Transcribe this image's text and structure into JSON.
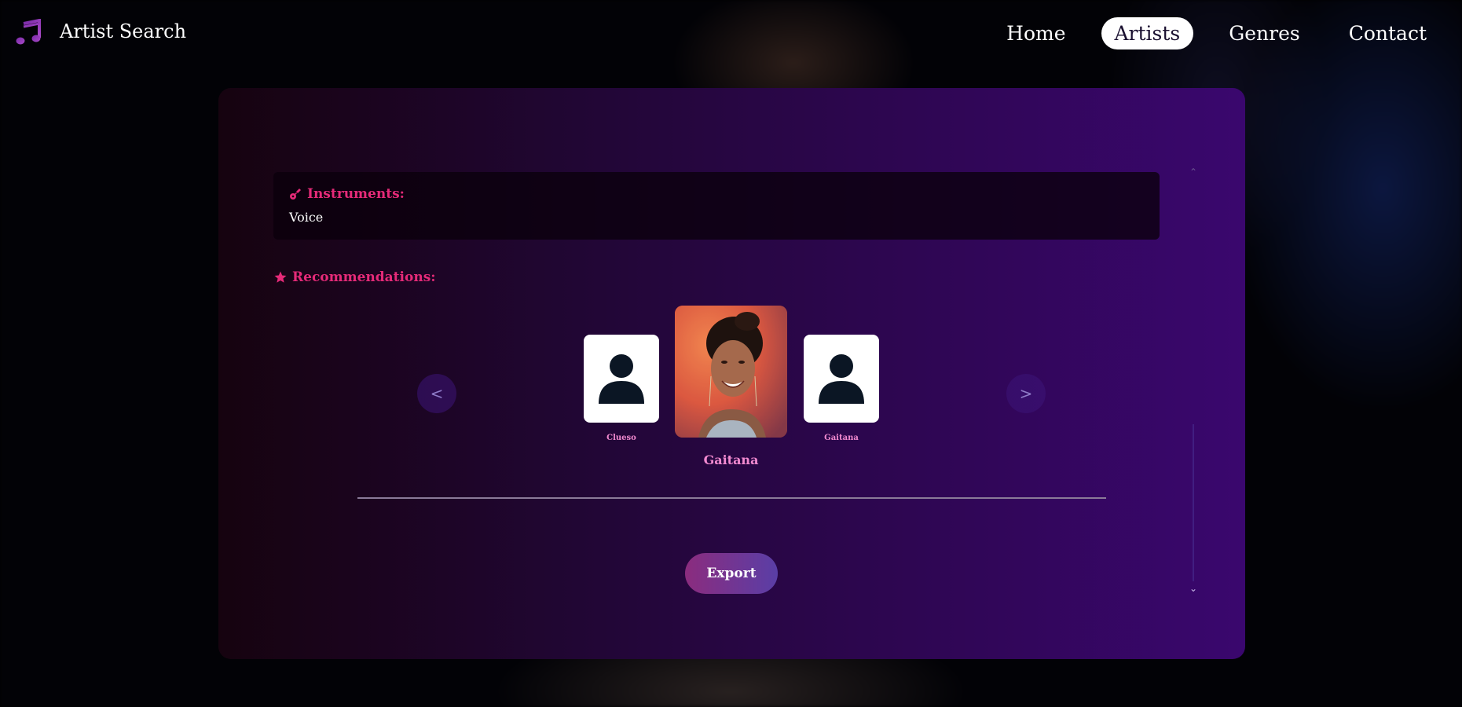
{
  "header": {
    "logo_icon": "music-note-icon",
    "title": "Artist Search",
    "nav": [
      {
        "label": "Home",
        "active": false
      },
      {
        "label": "Artists",
        "active": true
      },
      {
        "label": "Genres",
        "active": false
      },
      {
        "label": "Contact",
        "active": false
      }
    ]
  },
  "details": {
    "instruments": {
      "icon": "guitar-icon",
      "title": "Instruments:",
      "value": "Voice"
    },
    "recommendations": {
      "icon": "star-icon",
      "title": "Recommendations:",
      "prev_label": "<",
      "next_label": ">",
      "items": [
        {
          "name": "Clueso",
          "has_photo": false
        },
        {
          "name": "Gaitana",
          "has_photo": true,
          "selected": true
        },
        {
          "name": "Gaitana",
          "has_photo": false
        }
      ],
      "selected_name": "Gaitana"
    },
    "export_label": "Export"
  },
  "colors": {
    "accent": "#e52a78",
    "label_pink": "#f28ad0",
    "active_nav_bg": "#ffffff"
  }
}
